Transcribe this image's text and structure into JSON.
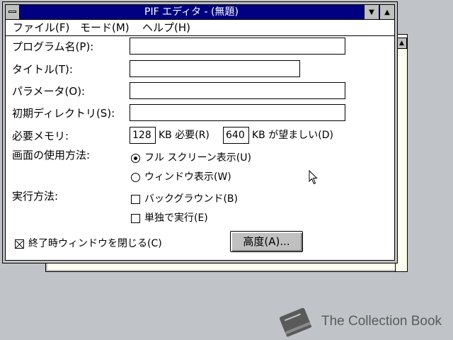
{
  "window": {
    "title": "PIF エディタ - (無題)",
    "minimize_glyph": "▼",
    "maximize_glyph": "▲"
  },
  "menu": {
    "file": "ファイル(F)",
    "mode": "モード(M)",
    "help": "ヘルプ(H)"
  },
  "form": {
    "program_label": "プログラム名(P):",
    "program_value": "",
    "title_label": "タイトル(T):",
    "title_value": "",
    "params_label": "パラメータ(O):",
    "params_value": "",
    "dir_label": "初期ディレクトリ(S):",
    "dir_value": "",
    "memory_label": "必要メモリ:",
    "mem_required_value": "128",
    "mem_required_suffix": "KB 必要(R)",
    "mem_desired_value": "640",
    "mem_desired_suffix": "KB が望ましい(D)",
    "screen_label": "画面の使用方法:",
    "screen_full": "フル スクリーン表示(U)",
    "screen_window": "ウィンドウ表示(W)",
    "exec_label": "実行方法:",
    "exec_background": "バックグラウンド(B)",
    "exec_exclusive": "単独で実行(E)",
    "close_on_exit": "終了時ウィンドウを閉じる(C)",
    "advanced_button": "高度(A)..."
  },
  "state": {
    "screen_mode": "full",
    "background": false,
    "exclusive": false,
    "close_on_exit": true
  },
  "watermark": {
    "text": "The Collection Book"
  }
}
